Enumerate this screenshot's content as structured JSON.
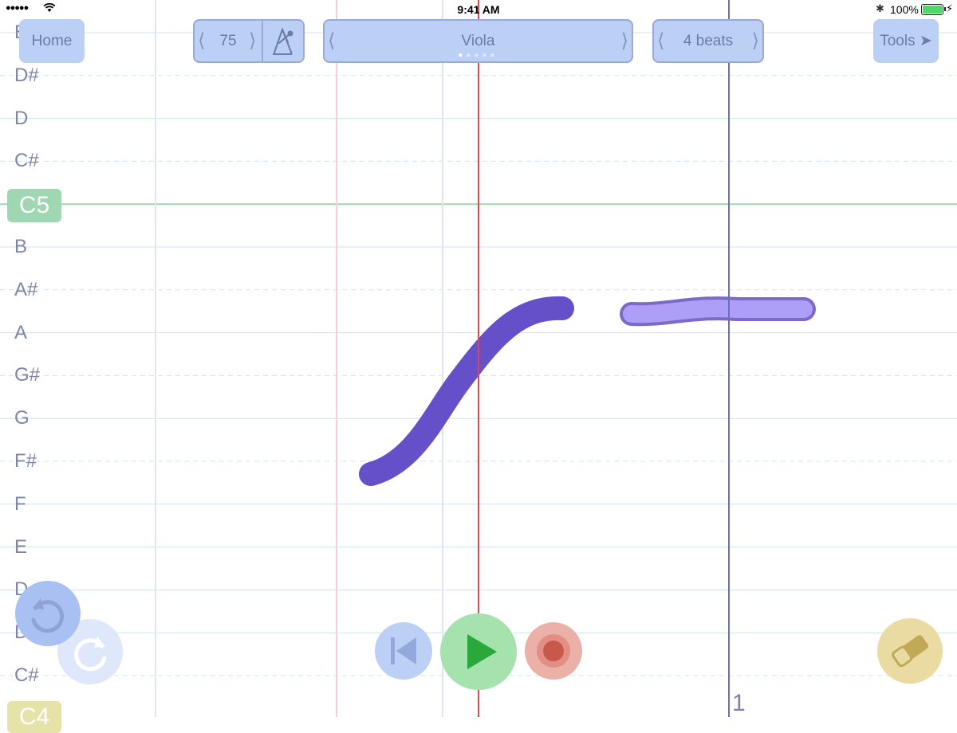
{
  "status_bar": {
    "signal": "●●●●●",
    "time": "9:41 AM",
    "battery_percent": "100%",
    "battery_level": 1.0
  },
  "header": {
    "home_label": "Home",
    "tempo_value": "75",
    "instrument": "Viola",
    "instrument_page_count": 5,
    "instrument_page_selected": 1,
    "beats_label": "4 beats",
    "tools_label": "Tools ➤"
  },
  "note_labels": [
    "E",
    "D#",
    "D",
    "C#",
    "C5",
    "B",
    "A#",
    "A",
    "G#",
    "G",
    "F#",
    "F",
    "E",
    "D",
    "D",
    "C#",
    "C4"
  ],
  "measure_number": "1",
  "icons": {
    "metronome": "metronome-icon",
    "undo": "undo-icon",
    "redo": "redo-icon",
    "rewind": "rewind-to-start-icon",
    "play": "play-icon",
    "record": "record-icon",
    "eraser": "eraser-icon"
  },
  "colors": {
    "button_bg": "#bcd0f6",
    "button_text": "#6c7aa7",
    "stroke_dark": "#6650c9",
    "stroke_light": "#ad9ef7",
    "playhead": "#d94a4a",
    "barline": "#6b6fc4",
    "play_green": "#2aa83c",
    "record_red": "#c8584c",
    "eraser_gold": "#c0aa55"
  }
}
